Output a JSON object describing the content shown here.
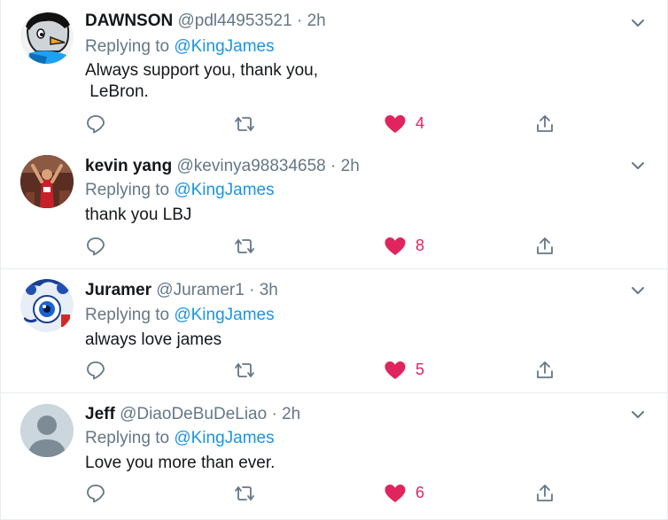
{
  "tweets": [
    {
      "name": "DAWNSON",
      "handle": "@pdl44953521",
      "sep": "·",
      "time": "2h",
      "replying_label": "Replying to",
      "replying_to": "@KingJames",
      "text": "Always support you, thank you,\n LeBron.",
      "likes": "4",
      "avatar": "penguin-cartoon-avatar"
    },
    {
      "name": "kevin yang",
      "handle": "@kevinya98834658",
      "sep": "·",
      "time": "2h",
      "replying_label": "Replying to",
      "replying_to": "@KingJames",
      "text": "thank you LBJ",
      "likes": "8",
      "avatar": "photo-avatar"
    },
    {
      "name": "Juramer",
      "handle": "@Juramer1",
      "sep": "·",
      "time": "3h",
      "replying_label": "Replying to",
      "replying_to": "@KingJames",
      "text": "always love james",
      "likes": "5",
      "avatar": "eye-cartoon-avatar"
    },
    {
      "name": "Jeff",
      "handle": "@DiaoDeBuDeLiao",
      "sep": "·",
      "time": "2h",
      "replying_label": "Replying to",
      "replying_to": "@KingJames",
      "text": "Love you more than ever.",
      "likes": "6",
      "avatar": "default-avatar"
    }
  ],
  "colors": {
    "link": "#1b95e0",
    "like": "#e0245e",
    "muted": "#657786",
    "separator": "#e6ecf0"
  }
}
